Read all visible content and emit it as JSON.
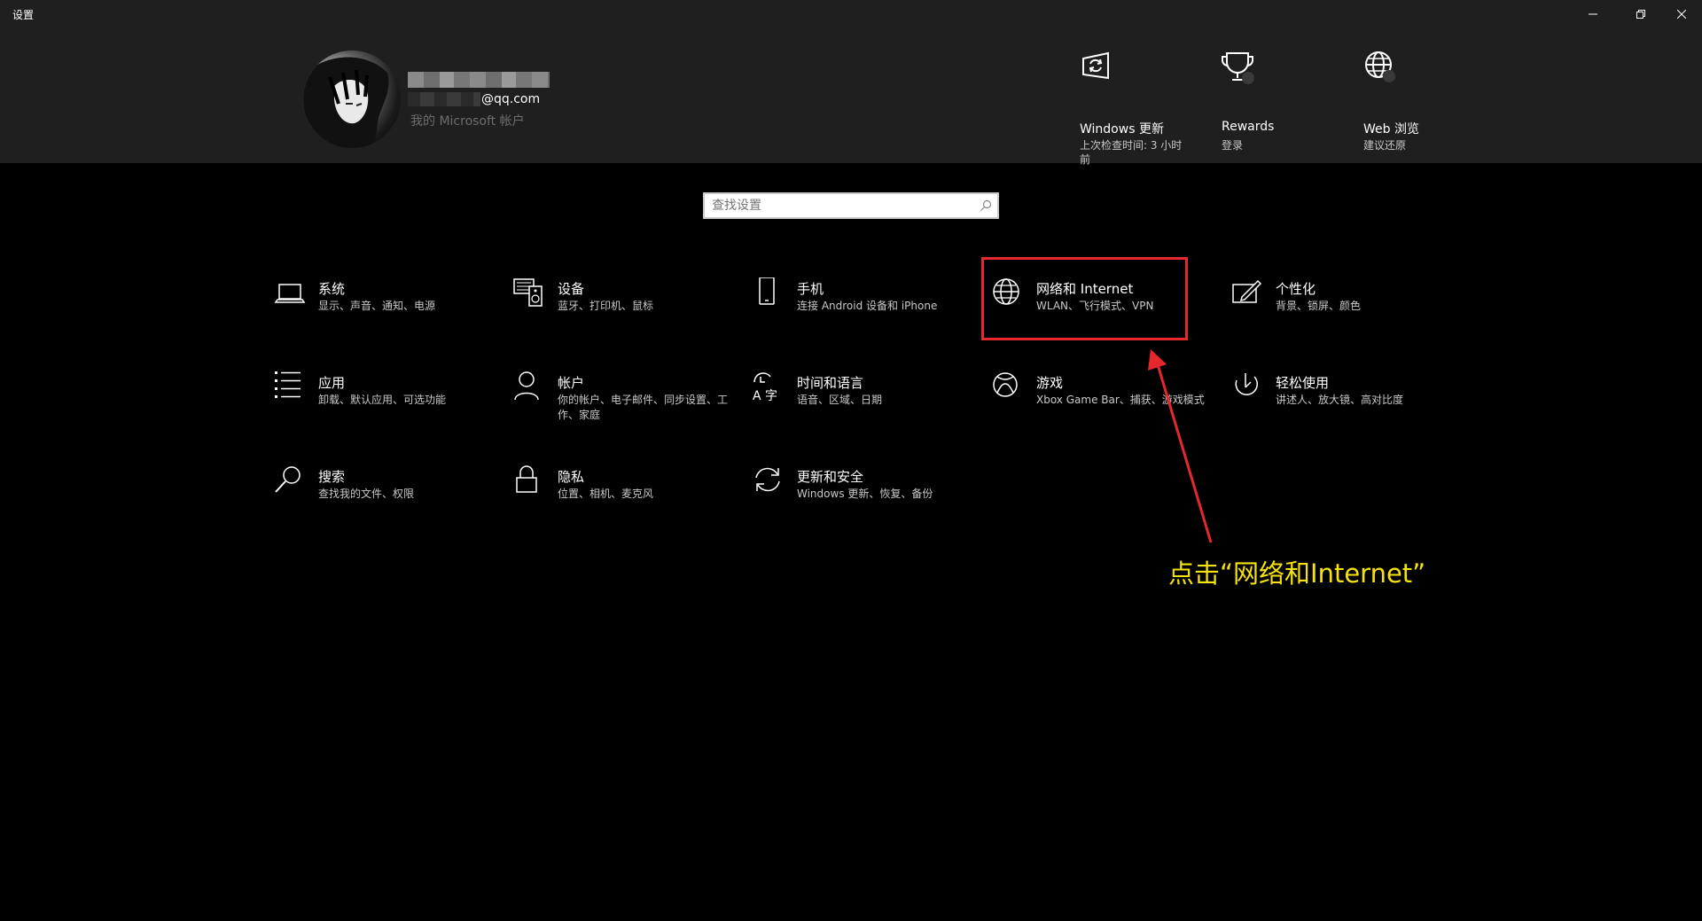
{
  "window": {
    "title": "设置"
  },
  "account": {
    "email_suffix": "@qq.com",
    "link_label": "我的 Microsoft 帐户"
  },
  "quick_links": [
    {
      "title": "Windows 更新",
      "subtitle": "上次检查时间: 3 小时前",
      "icon": "windows-update-icon"
    },
    {
      "title": "Rewards",
      "subtitle": "登录",
      "icon": "rewards-trophy-icon"
    },
    {
      "title": "Web 浏览",
      "subtitle": "建议还原",
      "icon": "web-globe-icon"
    }
  ],
  "search": {
    "placeholder": "查找设置"
  },
  "tiles": [
    {
      "title": "系统",
      "subtitle": "显示、声音、通知、电源",
      "icon": "laptop-icon"
    },
    {
      "title": "设备",
      "subtitle": "蓝牙、打印机、鼠标",
      "icon": "keyboard-speaker-icon"
    },
    {
      "title": "手机",
      "subtitle": "连接 Android 设备和 iPhone",
      "icon": "phone-icon"
    },
    {
      "title": "网络和 Internet",
      "subtitle": "WLAN、飞行模式、VPN",
      "icon": "globe-icon"
    },
    {
      "title": "个性化",
      "subtitle": "背景、锁屏、颜色",
      "icon": "pen-tablet-icon"
    },
    {
      "title": "应用",
      "subtitle": "卸载、默认应用、可选功能",
      "icon": "app-list-icon"
    },
    {
      "title": "帐户",
      "subtitle": "你的帐户、电子邮件、同步设置、工作、家庭",
      "icon": "person-icon"
    },
    {
      "title": "时间和语言",
      "subtitle": "语音、区域、日期",
      "icon": "time-language-icon"
    },
    {
      "title": "游戏",
      "subtitle": "Xbox Game Bar、捕获、游戏模式",
      "icon": "xbox-icon"
    },
    {
      "title": "轻松使用",
      "subtitle": "讲述人、放大镜、高对比度",
      "icon": "ease-of-access-icon"
    },
    {
      "title": "搜索",
      "subtitle": "查找我的文件、权限",
      "icon": "search-icon"
    },
    {
      "title": "隐私",
      "subtitle": "位置、相机、麦克风",
      "icon": "lock-icon"
    },
    {
      "title": "更新和安全",
      "subtitle": "Windows 更新、恢复、备份",
      "icon": "sync-icon"
    }
  ],
  "annotation": {
    "text": "点击“网络和Internet”",
    "color": "#f4e10d",
    "highlight_color": "#e5282b"
  }
}
